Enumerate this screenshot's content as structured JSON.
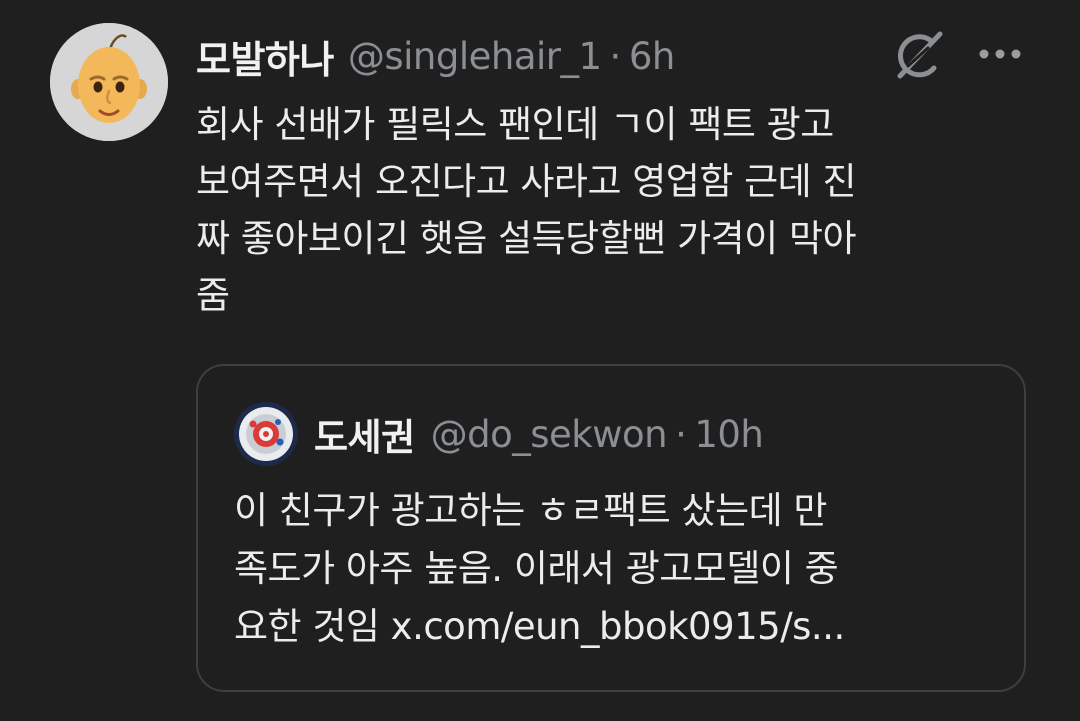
{
  "tweet": {
    "display_name": "모발하나",
    "handle": "@singlehair_1",
    "separator": "·",
    "time": "6h",
    "avatar_icon": "bald-man-memoji-avatar",
    "text_lines": [
      "회사 선배가 필릭스 팬인데 ㄱ이 팩트 광고",
      "보여주면서 오진다고 사라고 영업함 근데 진",
      "짜 좋아보이긴 햇음 설득당할뻔 가격이 막아",
      "줌"
    ]
  },
  "actions": {
    "grok_icon": "grok-icon",
    "more_icon": "more-options-icon"
  },
  "quote": {
    "display_name": "도세권",
    "handle": "@do_sekwon",
    "separator": "·",
    "time": "10h",
    "avatar_icon": "target-logo-avatar",
    "text_lines": [
      "이 친구가 광고하는 ㅎㄹ팩트 샀는데 만",
      "족도가 아주 높음. 이래서 광고모델이 중",
      "요한 것임 x.com/eun_bbok0915/s..."
    ]
  },
  "colors": {
    "background": "#1f1f1f",
    "primary_text": "#e7e9ea",
    "secondary_text": "#8b8f93",
    "card_border": "#3b3f43"
  }
}
